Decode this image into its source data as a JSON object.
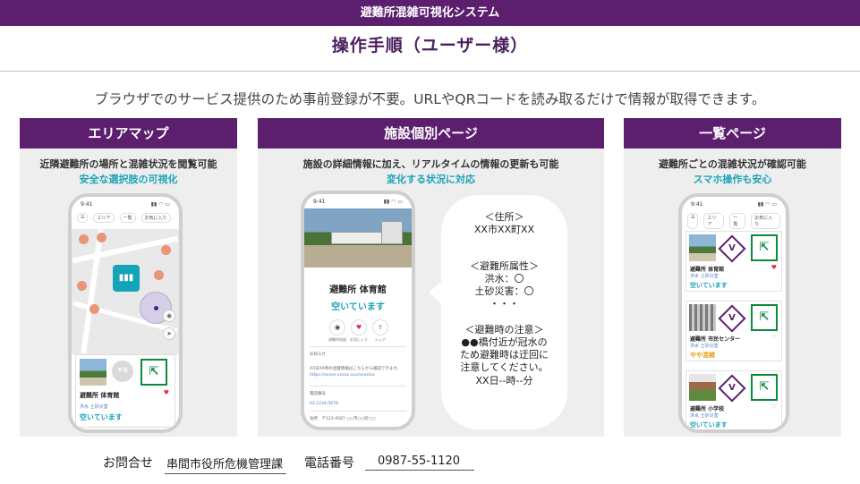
{
  "header": {
    "system_name": "避難所混雑可視化システム",
    "title": "操作手順（ユーザー様）",
    "lead": "ブラウザでのサービス提供のため事前登録が不要。URLやQRコードを読み取るだけで情報が取得できます。"
  },
  "panels": [
    {
      "title": "エリアマップ",
      "desc": "近隣避難所の場所と混雑状況を閲覧可能",
      "highlight": "安全な選択肢の可視化",
      "phone": {
        "time": "9:41",
        "nav": [
          "",
          "エリア",
          "一覧",
          "お気に入り"
        ],
        "card_name": "避難所 体育館",
        "card_tag": "洪水 土砂災害",
        "card_status": "空いています",
        "badge": "不可"
      }
    },
    {
      "title": "施設個別ページ",
      "desc": "施設の詳細情報に加え、リアルタイムの情報の更新も可能",
      "highlight": "変化する状況に対応",
      "phone": {
        "time": "9:41",
        "name": "避難所 体育館",
        "status": "空いています",
        "actions": [
          "避難所地図",
          "お気に入り",
          "シェア"
        ],
        "section1": "お知らせ",
        "note": "XX日XX時の混雑情報はこちらから確認できます。",
        "link": "https://xxxxx.xxxxx.xxx/xxxx/xx",
        "section2": "電話番号",
        "phone_no": "03-1234-5678",
        "section3": "住所",
        "address": "〒123-4567 ○○市○○町○○"
      },
      "bubble": {
        "address_head": "＜住所＞",
        "address": "XX市XX町XX",
        "attr_head": "＜避難所属性＞",
        "attr1": "洪水：〇",
        "attr2": "土砂災害：〇",
        "attr3": "・・・",
        "caution_head": "＜避難時の注意＞",
        "caution1": "●●橋付近が冠水の",
        "caution2": "ため避難時は迂回に",
        "caution3": "注意してください。",
        "caution4": "XX日--時--分"
      }
    },
    {
      "title": "一覧ページ",
      "desc": "避難所ごとの混雑状況が確認可能",
      "highlight": "スマホ操作も安心",
      "phone": {
        "time": "9:41",
        "nav": [
          "",
          "エリア",
          "一覧",
          "お気に入り"
        ],
        "items": [
          {
            "name": "避難所 体育館",
            "tag": "洪水 土砂災害",
            "status": "空いています",
            "status_color": "#1aa3b8"
          },
          {
            "name": "避難所 市民センター",
            "tag": "洪水 土砂災害",
            "status": "やや混雑",
            "status_color": "#e3a21a"
          },
          {
            "name": "避難所 小学校",
            "tag": "洪水 土砂災害",
            "status": "空いています",
            "status_color": "#1aa3b8"
          }
        ]
      }
    }
  ],
  "footer": {
    "contact_label": "お問合せ",
    "contact_value": "串間市役所危機管理課",
    "tel_label": "電話番号",
    "tel_value": "0987-55-1120"
  },
  "colors": {
    "brand": "#5b1f6e",
    "accent": "#1aa3b8",
    "exit_green": "#0c8a3a"
  }
}
